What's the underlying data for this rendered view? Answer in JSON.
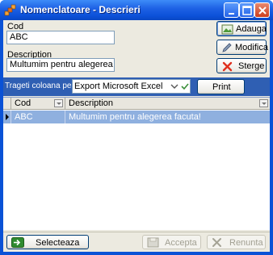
{
  "window": {
    "title": "Nomenclatoare - Descrieri",
    "buttons": [
      "minimize",
      "maximize",
      "close"
    ]
  },
  "form": {
    "cod_label": "Cod",
    "cod_value": "ABC",
    "description_label": "Description",
    "description_value": "Multumim pentru alegerea facuta!"
  },
  "side_buttons": {
    "add": "Adauga",
    "edit": "Modifica",
    "delete": "Sterge"
  },
  "export_bar": {
    "label": "Trageti coloana pentru grupare",
    "label_visible": "Trageti coloana pent",
    "selected_option": "Export Microsoft Excel",
    "print": "Print"
  },
  "grid": {
    "columns": [
      "Cod",
      "Description"
    ],
    "rows": [
      {
        "cod": "ABC",
        "description": "Multumim pentru alegerea facuta!"
      }
    ]
  },
  "footer": {
    "select": "Selecteaza",
    "accept": "Accepta",
    "cancel": "Renunta"
  },
  "colors": {
    "title_bar": "#0b50d8",
    "band": "#2f5fb3",
    "selected_row": "#8fb0df",
    "client": "#eceae0"
  }
}
